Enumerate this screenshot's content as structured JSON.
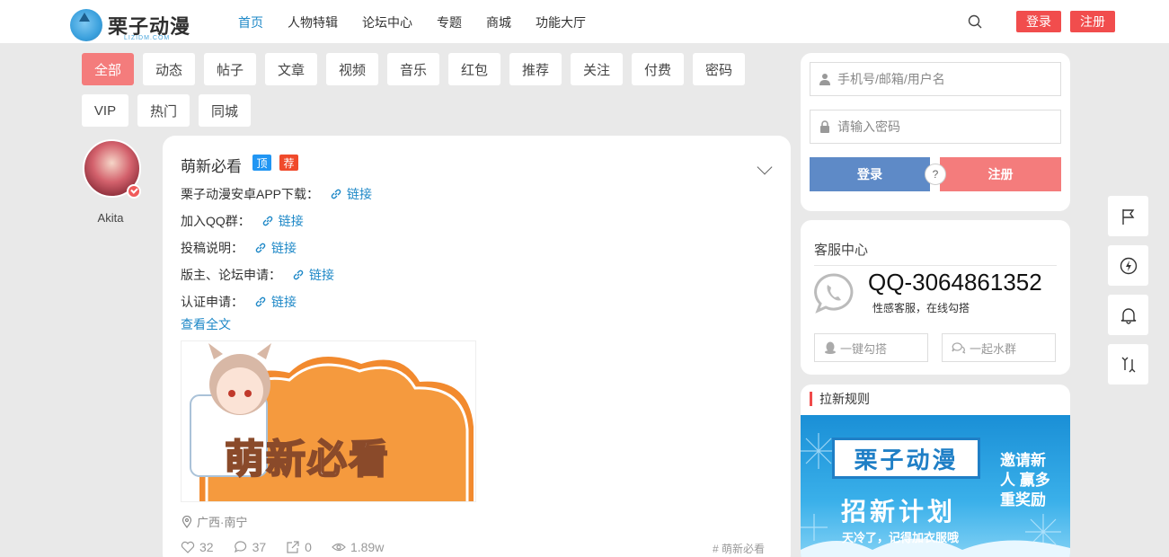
{
  "header": {
    "logo_text": "栗子动漫",
    "logo_sub": "LIZIDM.COM",
    "nav": [
      "首页",
      "人物特辑",
      "论坛中心",
      "专题",
      "商城",
      "功能大厅"
    ],
    "login": "登录",
    "register": "注册"
  },
  "filters": {
    "row1": [
      "全部",
      "动态",
      "帖子",
      "文章",
      "视频",
      "音乐",
      "红包",
      "推荐",
      "关注",
      "付费",
      "密码"
    ],
    "row2": [
      "VIP",
      "热门",
      "同城"
    ]
  },
  "author": {
    "name": "Akita"
  },
  "post": {
    "title": "萌新必看",
    "badge_top": "顶",
    "badge_rec": "荐",
    "lines": [
      {
        "label": "栗子动漫安卓APP下载：",
        "link": "链接"
      },
      {
        "label": "加入QQ群：",
        "link": "链接"
      },
      {
        "label": "投稿说明：",
        "link": "链接"
      },
      {
        "label": "版主、论坛申请：",
        "link": "链接"
      },
      {
        "label": "认证申请：",
        "link": "链接"
      }
    ],
    "read_more": "查看全文",
    "image_text": "萌新必看",
    "location": "广西·南宁",
    "likes": "32",
    "comments": "37",
    "shares": "0",
    "views": "1.89w",
    "tag": "# 萌新必看"
  },
  "login_panel": {
    "username_placeholder": "手机号/邮箱/用户名",
    "password_placeholder": "请输入密码",
    "login": "登录",
    "help": "?",
    "register": "注册"
  },
  "service": {
    "title": "客服中心",
    "qq": "QQ-3064861352",
    "sub": "性感客服，在线勾搭",
    "btn1": "一键勾搭",
    "btn2": "一起水群"
  },
  "rules": {
    "title": "拉新规则",
    "banner_box": "栗子动漫",
    "banner_big": "招新计划",
    "banner_small": "天冷了，记得加衣服哦",
    "banner_side": "邀请新人 赢多重奖励"
  },
  "colors": {
    "accent_blue": "#1e88c7",
    "red": "#f14d4d",
    "pink": "#f47c7c",
    "login_blue": "#5e8ac7"
  }
}
